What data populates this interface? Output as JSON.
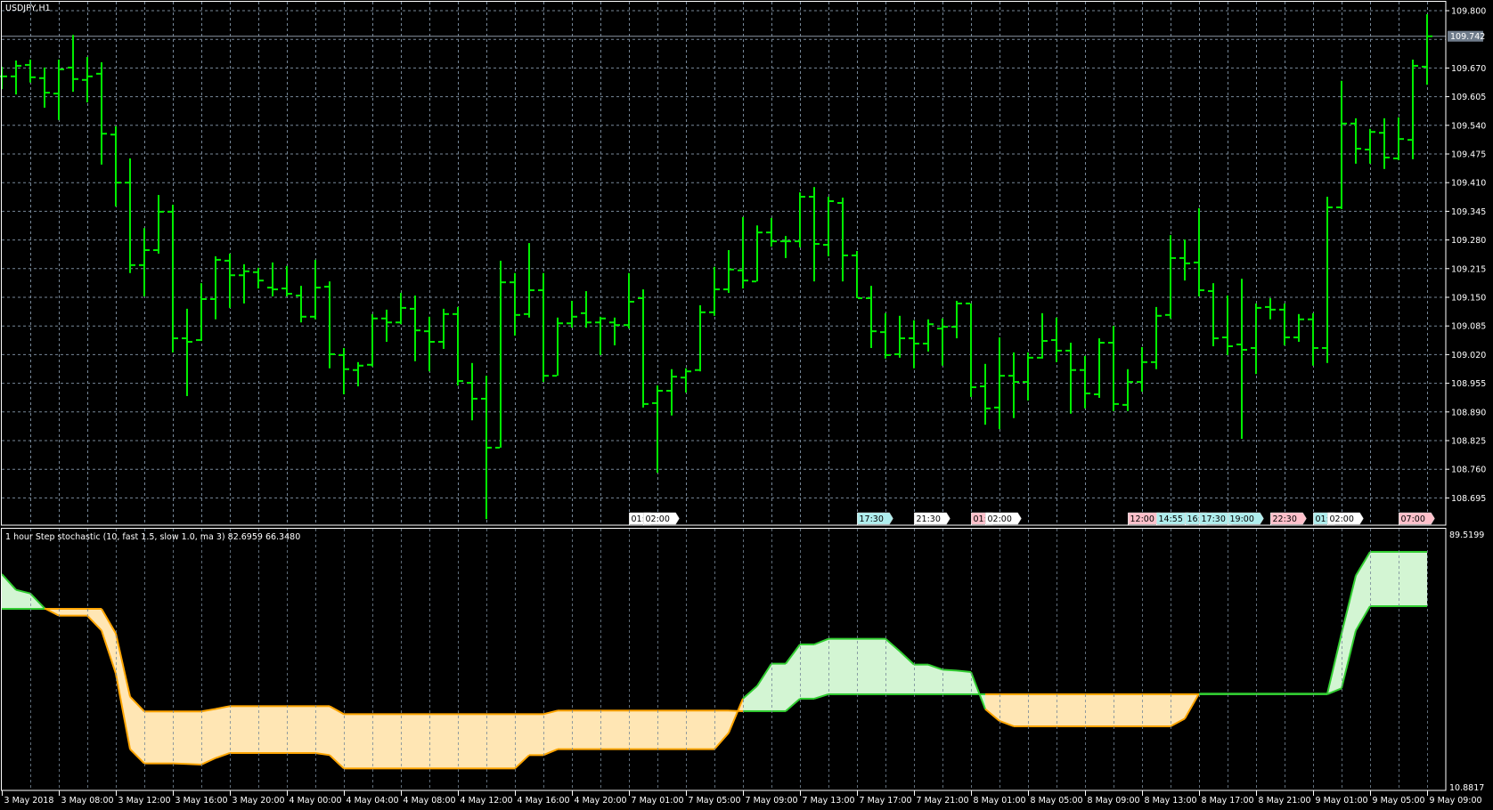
{
  "window": {
    "title": "USDJPY,H1"
  },
  "colors": {
    "background": "#000000",
    "bars": "#00EE00",
    "grid": "#778899",
    "frame": "#FFFFFF",
    "current_price_line": "#8A96A4",
    "fast_line": "#32CD32",
    "fast_fill": "#D3F5D3",
    "slow_line": "#FFA500",
    "slow_fill": "#FFE6B4",
    "tag_white": "#FFFFFF",
    "tag_cyan": "#AFEEEE",
    "tag_pink": "#FFC0CB"
  },
  "price_axis": {
    "labels": [
      "109.800",
      "109.670",
      "109.605",
      "109.540",
      "109.475",
      "109.410",
      "109.345",
      "109.280",
      "109.215",
      "109.150",
      "109.085",
      "109.020",
      "108.955",
      "108.890",
      "108.825",
      "108.760",
      "108.695"
    ],
    "grid_values": [
      109.8,
      109.735,
      109.67,
      109.605,
      109.54,
      109.475,
      109.41,
      109.345,
      109.28,
      109.215,
      109.15,
      109.085,
      109.02,
      108.955,
      108.89,
      108.825,
      108.76,
      108.695
    ],
    "current_price": "109.742"
  },
  "time_axis": {
    "labels": [
      "3 May 2018",
      "3 May 08:00",
      "3 May 12:00",
      "3 May 16:00",
      "3 May 20:00",
      "4 May 00:00",
      "4 May 04:00",
      "4 May 08:00",
      "4 May 12:00",
      "4 May 16:00",
      "4 May 20:00",
      "7 May 01:00",
      "7 May 05:00",
      "7 May 09:00",
      "7 May 13:00",
      "7 May 17:00",
      "7 May 21:00",
      "8 May 01:00",
      "8 May 05:00",
      "8 May 09:00",
      "8 May 13:00",
      "8 May 17:00",
      "8 May 21:00",
      "9 May 01:00",
      "9 May 05:00",
      "9 May 09:00"
    ]
  },
  "event_tags": [
    {
      "text": "01:",
      "color": "white",
      "bar": 44
    },
    {
      "text": "02:00",
      "color": "white",
      "bar": 45
    },
    {
      "text": "17:30",
      "color": "cyan",
      "bar": 60
    },
    {
      "text": "21:30",
      "color": "white",
      "bar": 64
    },
    {
      "text": "01:",
      "color": "pink",
      "bar": 68
    },
    {
      "text": "02:00",
      "color": "white",
      "bar": 69
    },
    {
      "text": "12:00",
      "color": "pink",
      "bar": 79
    },
    {
      "text": "14:55",
      "color": "cyan",
      "bar": 81
    },
    {
      "text": "16:",
      "color": "cyan",
      "bar": 83
    },
    {
      "text": "17:30",
      "color": "cyan",
      "bar": 84
    },
    {
      "text": "19:00",
      "color": "cyan",
      "bar": 86
    },
    {
      "text": "22:30",
      "color": "pink",
      "bar": 89
    },
    {
      "text": "01:",
      "color": "cyan",
      "bar": 92
    },
    {
      "text": "02:00",
      "color": "white",
      "bar": 93
    },
    {
      "text": "07:00",
      "color": "pink",
      "bar": 98
    }
  ],
  "indicator": {
    "title": "1 hour Step stochastic (10, fast 1.5, slow 1.0, ma 3) 82.6959 66.3480",
    "scale_max": "89.5199",
    "scale_min": "10.8817"
  },
  "chart_data": [
    {
      "type": "ohlc",
      "title": "USDJPY,H1",
      "ylim": [
        108.63,
        109.82
      ],
      "bars_ohlc": [
        [
          109.651,
          109.673,
          109.622,
          109.651
        ],
        [
          109.651,
          109.687,
          109.61,
          109.675
        ],
        [
          109.677,
          109.689,
          109.637,
          109.649
        ],
        [
          109.647,
          109.671,
          109.58,
          109.614
        ],
        [
          109.612,
          109.689,
          109.552,
          109.667
        ],
        [
          109.671,
          109.745,
          109.616,
          109.645
        ],
        [
          109.643,
          109.695,
          109.592,
          109.651
        ],
        [
          109.657,
          109.683,
          109.451,
          109.521
        ],
        [
          109.519,
          109.538,
          109.356,
          109.41
        ],
        [
          109.41,
          109.465,
          109.205,
          109.223
        ],
        [
          109.223,
          109.307,
          109.152,
          109.257
        ],
        [
          109.257,
          109.382,
          109.249,
          109.344
        ],
        [
          109.344,
          109.36,
          109.025,
          109.057
        ],
        [
          109.057,
          109.124,
          108.926,
          109.049
        ],
        [
          109.053,
          109.182,
          109.051,
          109.146
        ],
        [
          109.146,
          109.243,
          109.1,
          109.235
        ],
        [
          109.233,
          109.249,
          109.126,
          109.2
        ],
        [
          109.2,
          109.225,
          109.136,
          109.209
        ],
        [
          109.207,
          109.217,
          109.17,
          109.188
        ],
        [
          109.172,
          109.229,
          109.152,
          109.168
        ],
        [
          109.17,
          109.221,
          109.152,
          109.158
        ],
        [
          109.154,
          109.176,
          109.093,
          109.106
        ],
        [
          109.106,
          109.235,
          109.1,
          109.172
        ],
        [
          109.174,
          109.186,
          108.989,
          109.021
        ],
        [
          109.019,
          109.035,
          108.93,
          108.987
        ],
        [
          108.985,
          109.003,
          108.948,
          108.995
        ],
        [
          108.997,
          109.112,
          108.993,
          109.102
        ],
        [
          109.102,
          109.122,
          109.049,
          109.093
        ],
        [
          109.093,
          109.16,
          109.089,
          109.126
        ],
        [
          109.124,
          109.154,
          109.005,
          109.075
        ],
        [
          109.073,
          109.106,
          108.982,
          109.049
        ],
        [
          109.049,
          109.124,
          109.033,
          109.112
        ],
        [
          109.112,
          109.128,
          108.95,
          108.96
        ],
        [
          108.956,
          109.001,
          108.871,
          108.92
        ],
        [
          108.92,
          108.972,
          108.647,
          108.809
        ],
        [
          108.809,
          109.233,
          108.809,
          109.184
        ],
        [
          109.184,
          109.205,
          109.063,
          109.11
        ],
        [
          109.112,
          109.273,
          109.104,
          109.166
        ],
        [
          109.166,
          109.205,
          108.958,
          108.972
        ],
        [
          108.972,
          109.104,
          108.972,
          109.091
        ],
        [
          109.091,
          109.142,
          109.081,
          109.106
        ],
        [
          109.114,
          109.164,
          109.081,
          109.093
        ],
        [
          109.093,
          109.106,
          109.019,
          109.102
        ],
        [
          109.093,
          109.104,
          109.041,
          109.087
        ],
        [
          109.087,
          109.205,
          109.079,
          109.14
        ],
        [
          109.148,
          109.168,
          108.9,
          108.908
        ],
        [
          108.91,
          108.95,
          108.752,
          108.938
        ],
        [
          108.938,
          108.987,
          108.882,
          108.97
        ],
        [
          108.968,
          108.989,
          108.934,
          108.982
        ],
        [
          108.985,
          109.132,
          108.982,
          109.116
        ],
        [
          109.116,
          109.219,
          109.108,
          109.168
        ],
        [
          109.168,
          109.257,
          109.16,
          109.213
        ],
        [
          109.211,
          109.332,
          109.17,
          109.188
        ],
        [
          109.186,
          109.313,
          109.186,
          109.297
        ],
        [
          109.297,
          109.33,
          109.265,
          109.277
        ],
        [
          109.277,
          109.289,
          109.239,
          109.277
        ],
        [
          109.277,
          109.388,
          109.263,
          109.378
        ],
        [
          109.378,
          109.4,
          109.186,
          109.271
        ],
        [
          109.269,
          109.378,
          109.243,
          109.368
        ],
        [
          109.364,
          109.376,
          109.186,
          109.245
        ],
        [
          109.245,
          109.255,
          109.148,
          109.148
        ],
        [
          109.148,
          109.176,
          109.035,
          109.073
        ],
        [
          109.071,
          109.114,
          109.011,
          109.019
        ],
        [
          109.021,
          109.108,
          109.013,
          109.057
        ],
        [
          109.057,
          109.098,
          108.989,
          109.045
        ],
        [
          109.045,
          109.1,
          109.027,
          109.089
        ],
        [
          109.079,
          109.102,
          108.995,
          109.083
        ],
        [
          109.083,
          109.142,
          109.057,
          109.136
        ],
        [
          109.136,
          109.136,
          108.924,
          108.946
        ],
        [
          108.948,
          108.999,
          108.861,
          108.898
        ],
        [
          108.9,
          109.059,
          108.851,
          108.972
        ],
        [
          108.972,
          109.025,
          108.876,
          108.958
        ],
        [
          108.958,
          109.025,
          108.916,
          109.013
        ],
        [
          109.013,
          109.114,
          109.011,
          109.051
        ],
        [
          109.053,
          109.104,
          109.003,
          109.029
        ],
        [
          109.029,
          109.047,
          108.886,
          108.985
        ],
        [
          108.985,
          109.017,
          108.898,
          108.932
        ],
        [
          108.93,
          109.057,
          108.922,
          109.047
        ],
        [
          109.047,
          109.085,
          108.892,
          108.908
        ],
        [
          108.906,
          108.987,
          108.892,
          108.958
        ],
        [
          108.958,
          109.037,
          108.936,
          109.003
        ],
        [
          109.003,
          109.128,
          108.987,
          109.108
        ],
        [
          109.11,
          109.291,
          109.102,
          109.239
        ],
        [
          109.239,
          109.281,
          109.188,
          109.227
        ],
        [
          109.229,
          109.352,
          109.152,
          109.166
        ],
        [
          109.164,
          109.182,
          109.039,
          109.057
        ],
        [
          109.059,
          109.154,
          109.019,
          109.039
        ],
        [
          109.043,
          109.192,
          108.829,
          109.031
        ],
        [
          109.035,
          109.136,
          108.976,
          109.126
        ],
        [
          109.128,
          109.148,
          109.1,
          109.122
        ],
        [
          109.122,
          109.136,
          109.041,
          109.059
        ],
        [
          109.059,
          109.112,
          109.049,
          109.1
        ],
        [
          109.1,
          109.114,
          108.995,
          109.035
        ],
        [
          109.035,
          109.378,
          109.001,
          109.354
        ],
        [
          109.354,
          109.641,
          109.35,
          109.544
        ],
        [
          109.544,
          109.556,
          109.453,
          109.487
        ],
        [
          109.485,
          109.532,
          109.453,
          109.525
        ],
        [
          109.523,
          109.556,
          109.441,
          109.467
        ],
        [
          109.465,
          109.558,
          109.461,
          109.509
        ],
        [
          109.507,
          109.689,
          109.463,
          109.675
        ],
        [
          109.673,
          109.792,
          109.632,
          109.742
        ]
      ]
    },
    {
      "type": "area",
      "title": "1 hour Step stochastic (10, fast 1.5, slow 1.0, ma 3)",
      "ylim": [
        10.8817,
        89.5199
      ],
      "series": [
        {
          "name": "fast",
          "values": [
            76.0,
            71.26,
            70.19,
            65.72,
            63.49,
            63.49,
            63.49,
            59.02,
            46.07,
            23.29,
            19.0,
            19.0,
            19.0,
            18.83,
            18.65,
            20.61,
            22.13,
            22.13,
            22.13,
            22.13,
            22.13,
            22.13,
            22.13,
            21.5,
            17.48,
            17.48,
            17.48,
            17.48,
            17.48,
            17.48,
            17.48,
            17.48,
            17.48,
            17.48,
            17.48,
            17.48,
            17.48,
            21.5,
            21.5,
            23.29,
            23.29,
            23.29,
            23.29,
            23.29,
            23.29,
            23.29,
            23.29,
            23.29,
            23.29,
            23.29,
            23.29,
            28.2,
            38.5,
            42.32,
            49.02,
            49.02,
            54.82,
            54.82,
            56.52,
            56.52,
            56.52,
            56.52,
            56.52,
            52.77,
            48.75,
            48.75,
            47.23,
            46.96,
            46.52,
            35.35,
            31.78,
            30.17,
            30.17,
            30.17,
            30.17,
            30.17,
            30.17,
            30.17,
            30.17,
            30.17,
            30.17,
            30.17,
            30.17,
            32.49,
            40.0,
            40.0,
            40.0,
            40.0,
            40.0,
            40.0,
            40.0,
            40.0,
            40.0,
            40.0,
            58.13,
            75.55,
            82.7,
            82.7,
            82.7,
            82.7,
            82.6959
          ]
        },
        {
          "name": "slow",
          "values": [
            65.54,
            65.54,
            65.54,
            65.54,
            65.54,
            65.54,
            65.54,
            65.54,
            58.13,
            39.1,
            34.64,
            34.64,
            34.64,
            34.64,
            34.64,
            35.4,
            36.24,
            36.24,
            36.24,
            36.24,
            36.24,
            36.24,
            36.24,
            36.24,
            33.83,
            33.83,
            33.83,
            33.83,
            33.83,
            33.83,
            33.83,
            33.83,
            33.83,
            33.83,
            33.83,
            33.83,
            33.83,
            33.83,
            33.83,
            34.9,
            34.9,
            34.9,
            34.9,
            34.9,
            34.9,
            34.9,
            34.9,
            34.9,
            34.9,
            34.9,
            34.9,
            34.9,
            34.73,
            34.73,
            34.73,
            34.73,
            38.48,
            38.48,
            39.82,
            39.82,
            39.82,
            39.82,
            39.82,
            39.82,
            39.82,
            39.82,
            39.82,
            39.82,
            39.82,
            39.82,
            39.82,
            39.82,
            39.82,
            39.82,
            39.82,
            39.82,
            39.82,
            39.82,
            39.82,
            39.82,
            39.82,
            39.82,
            39.82,
            39.82,
            39.82,
            39.82,
            39.82,
            39.82,
            39.82,
            39.82,
            39.82,
            39.82,
            39.82,
            39.82,
            41.61,
            59.02,
            66.35,
            66.35,
            66.35,
            66.35,
            66.348
          ]
        }
      ]
    }
  ]
}
